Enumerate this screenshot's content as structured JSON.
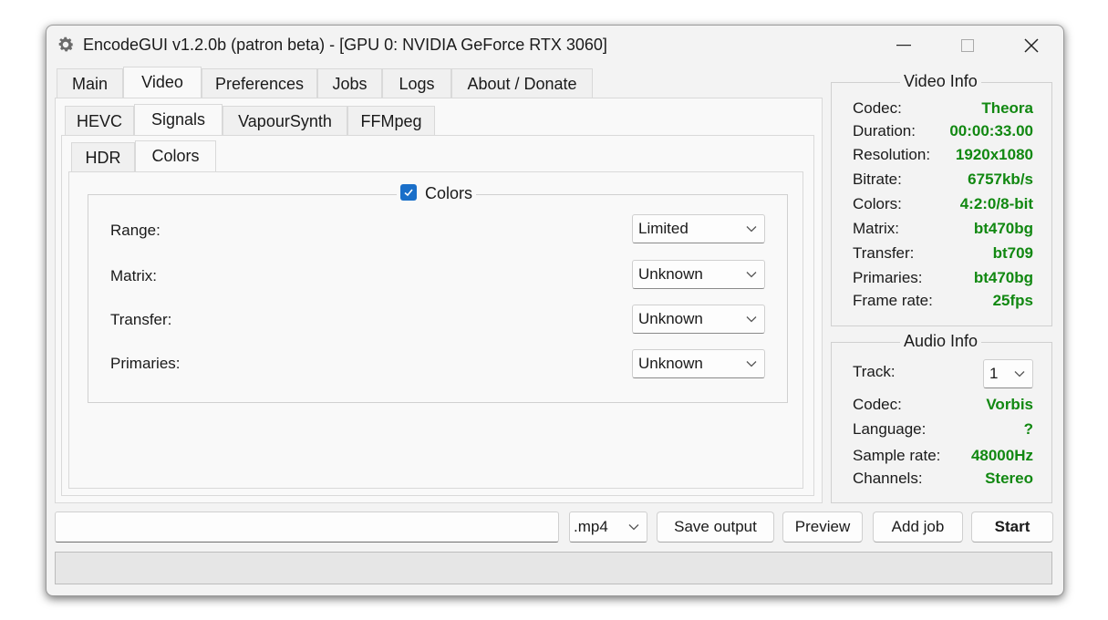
{
  "window": {
    "title": "EncodeGUI v1.2.0b (patron beta) - [GPU 0: NVIDIA GeForce RTX 3060]"
  },
  "main_tabs": [
    "Main",
    "Video",
    "Preferences",
    "Jobs",
    "Logs",
    "About / Donate"
  ],
  "video_tabs": [
    "HEVC",
    "Signals",
    "VapourSynth",
    "FFMpeg"
  ],
  "signal_tabs": [
    "HDR",
    "Colors"
  ],
  "colors_group": {
    "checkbox_label": "Colors",
    "checked": true,
    "fields": [
      {
        "label": "Range:",
        "value": "Limited"
      },
      {
        "label": "Matrix:",
        "value": "Unknown"
      },
      {
        "label": "Transfer:",
        "value": "Unknown"
      },
      {
        "label": "Primaries:",
        "value": "Unknown"
      }
    ]
  },
  "video_info": {
    "title": "Video Info",
    "rows": [
      {
        "label": "Codec:",
        "value": "Theora"
      },
      {
        "label": "Duration:",
        "value": "00:00:33.00"
      },
      {
        "label": "Resolution:",
        "value": "1920x1080"
      },
      {
        "label": "Bitrate:",
        "value": "6757kb/s"
      },
      {
        "label": "Colors:",
        "value": "4:2:0/8-bit"
      },
      {
        "label": "Matrix:",
        "value": "bt470bg"
      },
      {
        "label": "Transfer:",
        "value": "bt709"
      },
      {
        "label": "Primaries:",
        "value": "bt470bg"
      },
      {
        "label": "Frame rate:",
        "value": "25fps"
      }
    ]
  },
  "audio_info": {
    "title": "Audio Info",
    "track_label": "Track:",
    "track_value": "1",
    "rows": [
      {
        "label": "Codec:",
        "value": "Vorbis"
      },
      {
        "label": "Language:",
        "value": "?"
      },
      {
        "label": "Sample rate:",
        "value": "48000Hz"
      },
      {
        "label": "Channels:",
        "value": "Stereo"
      }
    ]
  },
  "bottom_bar": {
    "output_path": "",
    "extension": ".mp4",
    "save_output": "Save output",
    "preview": "Preview",
    "add_job": "Add job",
    "start": "Start"
  },
  "colors": {
    "accent": "#1a6fc9",
    "value_green": "#118811"
  }
}
